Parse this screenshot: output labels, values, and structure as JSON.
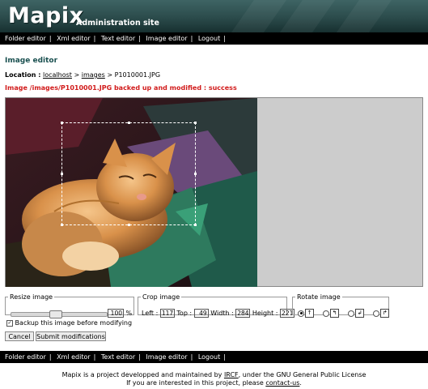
{
  "header": {
    "logo": "Mapix",
    "subtitle": "Administration site"
  },
  "nav": [
    "Folder editor",
    "Xml editor",
    "Text editor",
    "Image editor",
    "Logout"
  ],
  "page": {
    "title": "Image editor",
    "location_label": "Location :",
    "breadcrumb": [
      "localhost",
      "images",
      "P1010001.JPG"
    ],
    "breadcrumb_sep": ">",
    "status": "Image /images/P1010001.JPG backed up and modified : success"
  },
  "resize": {
    "legend": "Resize image",
    "value": "100",
    "unit": "%",
    "slider_fraction": 0.45
  },
  "crop": {
    "legend": "Crop image",
    "left_label": "Left :",
    "left": "117",
    "top_label": "Top :",
    "top": "49",
    "width_label": "Width :",
    "width": "284",
    "height_label": "Height :",
    "height": "221"
  },
  "rotate": {
    "legend": "Rotate image",
    "options": [
      "↑",
      "↰",
      "↲",
      "↱"
    ],
    "selected": 0
  },
  "backup": {
    "label": "Backup this image before modifying",
    "checked": true
  },
  "buttons": {
    "cancel": "Cancel",
    "submit": "Submit modifications"
  },
  "footer": {
    "line1_pre": "Mapix is a project developped and maintained by ",
    "line1_link": "IRCF",
    "line1_post": ", under the GNU General Public License",
    "line2_pre": "If you are interested in this project, please ",
    "line2_link": "contact-us",
    "line2_post": "."
  },
  "colors": {
    "header": "#2b4b4b",
    "status": "#d11b1b",
    "title": "#1a5050"
  }
}
